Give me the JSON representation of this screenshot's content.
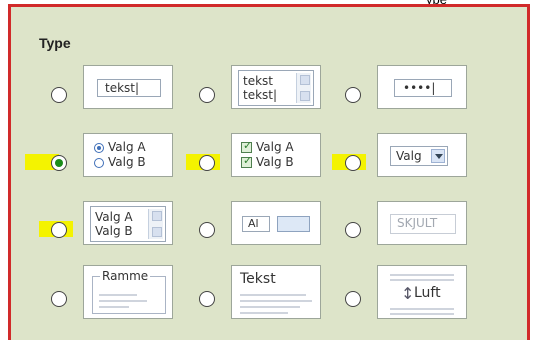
{
  "top_fragment": "ype",
  "panel": {
    "title": "Type"
  },
  "cards": {
    "text_single": "tekst|",
    "text_multi_line1": "tekst",
    "text_multi_line2": "tekst|",
    "password": "••••|",
    "radio_options": [
      "Valg A",
      "Valg B"
    ],
    "check_options": [
      "Valg A",
      "Valg B"
    ],
    "dropdown_value": "Valg",
    "listbox_options": [
      "Valg A",
      "Valg B"
    ],
    "file_upload_text": "Al",
    "hidden_text": "SKJULT",
    "frame_text": "Ramme",
    "heading_text": "Tekst",
    "spacing_text": "Luft"
  },
  "selection": {
    "selected_index": 3
  }
}
